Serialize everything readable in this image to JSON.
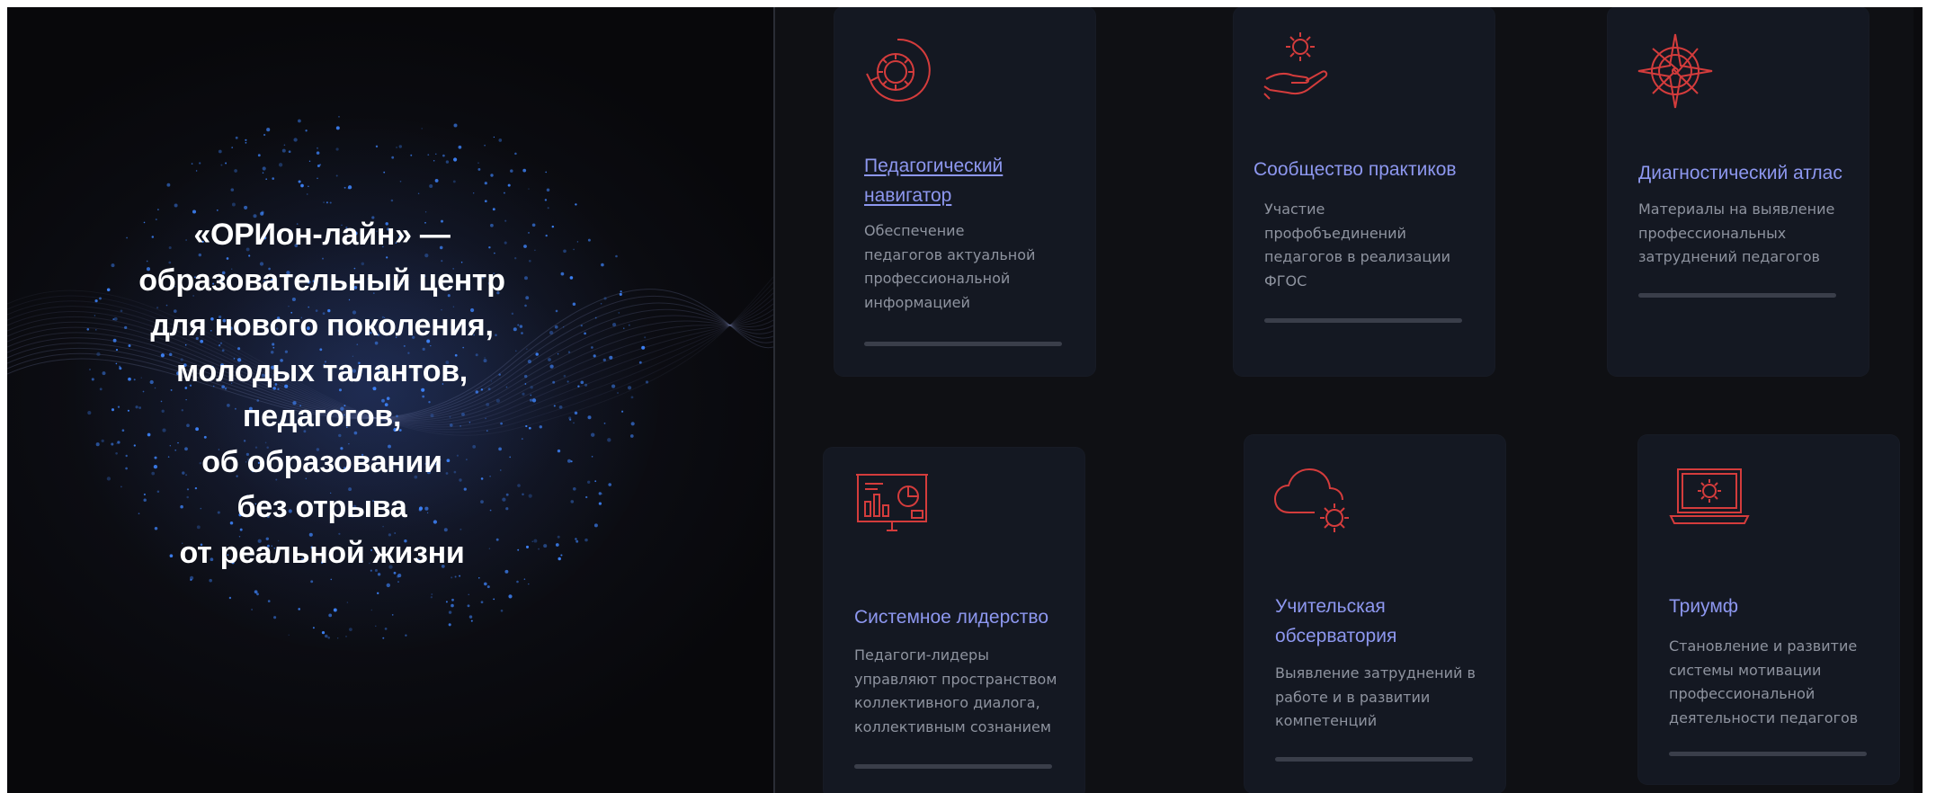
{
  "hero": {
    "text": "«ОРИон-лайн» —\nобразовательный центр\nдля нового поколения,\nмолодых талантов,\nпедагогов,\nоб образовании\nбез отрыва\nот реальной жизни"
  },
  "cards": [
    {
      "title": "Педагогический навигатор",
      "description": "Обеспечение педагогов актуальной профессиональной информацией",
      "icon": "gear-refresh-icon"
    },
    {
      "title": "Сообщество практиков",
      "description": "Участие профобъединений педагогов в реализации ФГОС",
      "icon": "gear-hand-icon"
    },
    {
      "title": "Диагностический атлас",
      "description": "Материалы на выявление профессиональных затруднений педагогов",
      "icon": "compass-rose-icon"
    },
    {
      "title": "Системное лидерство",
      "description": "Педагоги-лидеры управляют пространством коллективного диалога, коллективным сознанием",
      "icon": "presentation-board-icon"
    },
    {
      "title": "Учительская обсерватория",
      "description": "Выявление затруднений в работе и в развитии компетенций",
      "icon": "cloud-gear-icon"
    },
    {
      "title": "Триумф",
      "description": "Становление и развитие системы мотивации профессиональной деятельности педагогов",
      "icon": "laptop-gear-icon"
    }
  ],
  "colors": {
    "accent_title": "#8d97ef",
    "icon_red": "#d43c3c",
    "background": "#0f1014",
    "card": "#141822"
  }
}
